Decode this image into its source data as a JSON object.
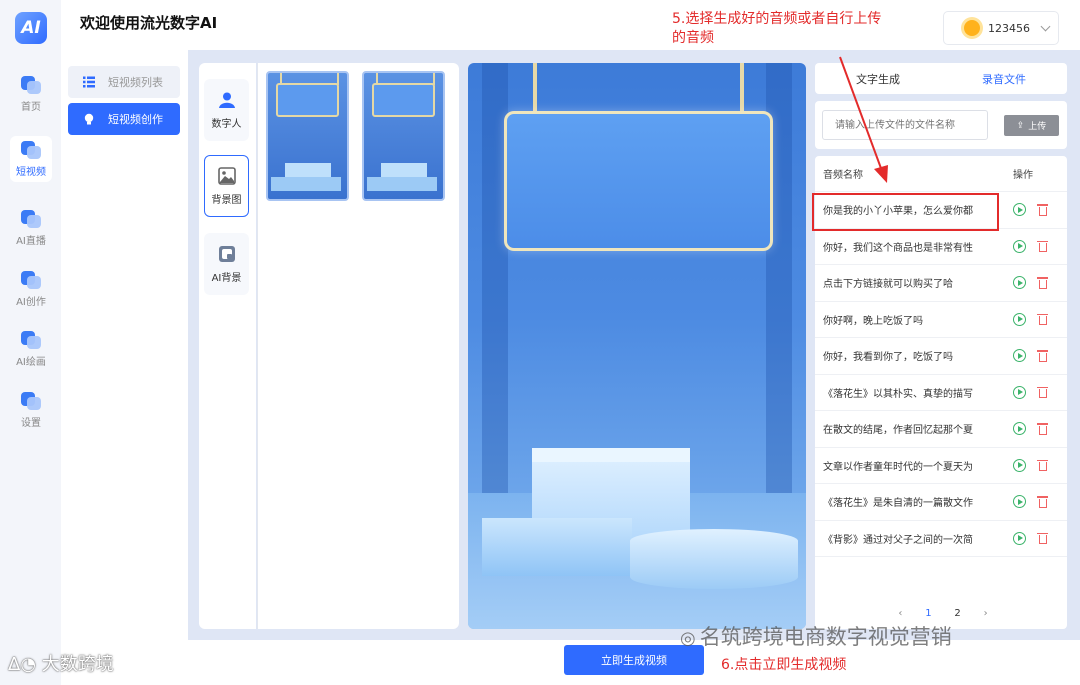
{
  "app": {
    "logo_text": "AI",
    "title": "欢迎使用流光数字AI"
  },
  "user": {
    "name": "123456"
  },
  "leftnav": [
    {
      "label": "首页",
      "active": false
    },
    {
      "label": "短视频",
      "active": true
    },
    {
      "label": "AI直播",
      "active": false
    },
    {
      "label": "AI创作",
      "active": false
    },
    {
      "label": "AI绘画",
      "active": false
    },
    {
      "label": "设置",
      "active": false
    }
  ],
  "subnav": {
    "list_label": "短视频列表",
    "create_label": "短视频创作"
  },
  "tabs": [
    {
      "label": "数字人"
    },
    {
      "label": "背景图"
    },
    {
      "label": "AI背景"
    }
  ],
  "audio": {
    "tab_text": "文字生成",
    "tab_record": "录音文件",
    "search_placeholder": "请输入上传文件的文件名称",
    "upload_label": "上传",
    "col_name": "音频名称",
    "col_action": "操作",
    "rows": [
      "你是我的小丫小苹果，怎么爱你都",
      "你好，我们这个商品也是非常有性",
      "点击下方链接就可以购买了哈",
      "你好啊，晚上吃饭了吗",
      "你好，我看到你了，吃饭了吗",
      "《落花生》以其朴实、真挚的描写",
      "在散文的结尾，作者回忆起那个夏",
      "文章以作者童年时代的一个夏天为",
      "《落花生》是朱自清的一篇散文作",
      "《背影》通过对父子之间的一次简"
    ],
    "pages": [
      "1",
      "2"
    ]
  },
  "generate_label": "立即生成视频",
  "annotations": {
    "step5_line1": "5.选择生成好的音频或者自行上传",
    "step5_line2": "的音频",
    "step6": "6.点击立即生成视频"
  },
  "watermarks": {
    "wechat": "名筑跨境电商数字视觉营销",
    "corner": "大数跨境"
  },
  "colors": {
    "accent": "#2f6bff",
    "annotation": "#e32b2b",
    "play": "#3bb36a",
    "delete": "#f06262"
  }
}
